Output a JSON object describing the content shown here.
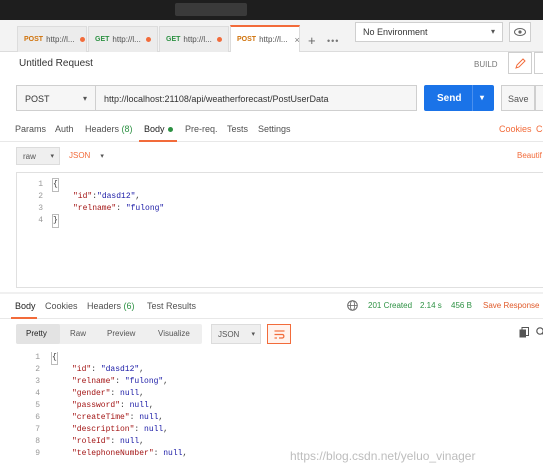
{
  "tabs": [
    {
      "method": "POST",
      "url": "http://l...",
      "modified": true,
      "active": false
    },
    {
      "method": "GET",
      "url": "http://l...",
      "modified": true,
      "active": false
    },
    {
      "method": "GET",
      "url": "http://l...",
      "modified": true,
      "active": false
    },
    {
      "method": "POST",
      "url": "http://l...",
      "modified": false,
      "active": true
    }
  ],
  "tab_more": "•••",
  "environment": {
    "selected": "No Environment"
  },
  "request": {
    "title": "Untitled Request",
    "build_label": "BUILD",
    "method": "POST",
    "url": "http://localhost:21108/api/weatherforecast/PostUserData",
    "send_label": "Send",
    "save_label": "Save"
  },
  "request_tabs": {
    "params": "Params",
    "auth": "Auth",
    "headers": "Headers",
    "headers_count": "(8)",
    "body": "Body",
    "prereq": "Pre-req.",
    "tests": "Tests",
    "settings": "Settings",
    "cookies": "Cookies",
    "cookies_cut": "Co"
  },
  "body_options": {
    "mode": "raw",
    "format": "JSON",
    "beautify": "Beautif"
  },
  "request_body": {
    "lines": [
      {
        "n": "1",
        "text": "{"
      },
      {
        "n": "2",
        "key": "\"id\"",
        "sep": ":",
        "value": "\"dasd12\"",
        "trail": ","
      },
      {
        "n": "3",
        "key": "\"relname\"",
        "sep": ": ",
        "value": "\"fulong\"",
        "trail": ""
      },
      {
        "n": "4",
        "text": "}"
      }
    ]
  },
  "response_tabs": {
    "body": "Body",
    "cookies": "Cookies",
    "headers": "Headers",
    "headers_count": "(6)",
    "test_results": "Test Results"
  },
  "response_meta": {
    "status": "201 Created",
    "time": "2.14 s",
    "size": "456 B",
    "save_response": "Save Response"
  },
  "response_view": {
    "pretty": "Pretty",
    "raw": "Raw",
    "preview": "Preview",
    "visualize": "Visualize",
    "format": "JSON"
  },
  "response_body": {
    "lines": [
      {
        "n": "1",
        "text": "{"
      },
      {
        "n": "2",
        "key": "\"id\"",
        "sep": ": ",
        "value": "\"dasd12\"",
        "trail": ","
      },
      {
        "n": "3",
        "key": "\"relname\"",
        "sep": ": ",
        "value": "\"fulong\"",
        "trail": ","
      },
      {
        "n": "4",
        "key": "\"gender\"",
        "sep": ": ",
        "value": "null",
        "trail": ","
      },
      {
        "n": "5",
        "key": "\"password\"",
        "sep": ": ",
        "value": "null",
        "trail": ","
      },
      {
        "n": "6",
        "key": "\"createTime\"",
        "sep": ": ",
        "value": "null",
        "trail": ","
      },
      {
        "n": "7",
        "key": "\"description\"",
        "sep": ": ",
        "value": "null",
        "trail": ","
      },
      {
        "n": "8",
        "key": "\"roleId\"",
        "sep": ": ",
        "value": "null",
        "trail": ","
      },
      {
        "n": "9",
        "key": "\"telephoneNumber\"",
        "sep": ": ",
        "value": "null",
        "trail": ","
      }
    ]
  },
  "watermark": "https://blog.csdn.net/yeluo_vinager",
  "colors": {
    "accent": "#f26b3a",
    "send": "#1a73e8",
    "success": "#2d9143",
    "post": "#d0720a",
    "get": "#2d9143"
  }
}
